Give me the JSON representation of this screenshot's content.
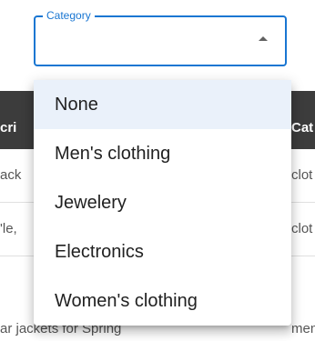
{
  "select": {
    "label": "Category",
    "value": "",
    "arrow_icon": "arrow-drop-up-icon"
  },
  "menu": {
    "items": [
      {
        "label": "None",
        "selected": true
      },
      {
        "label": "Men's clothing",
        "selected": false
      },
      {
        "label": "Jewelery",
        "selected": false
      },
      {
        "label": "Electronics",
        "selected": false
      },
      {
        "label": "Women's clothing",
        "selected": false
      }
    ]
  },
  "table": {
    "header": {
      "left": "cri",
      "right": "Cat"
    },
    "rows": [
      {
        "left": "ack",
        "right": "clot"
      },
      {
        "left": "'le,",
        "right": "clot"
      },
      {
        "left": "ar jackets for Spring",
        "right": "men's clot"
      }
    ]
  },
  "colors": {
    "accent": "#1976d2",
    "header_bg": "#3c3c3c",
    "selected_bg": "#eaf1fa"
  }
}
